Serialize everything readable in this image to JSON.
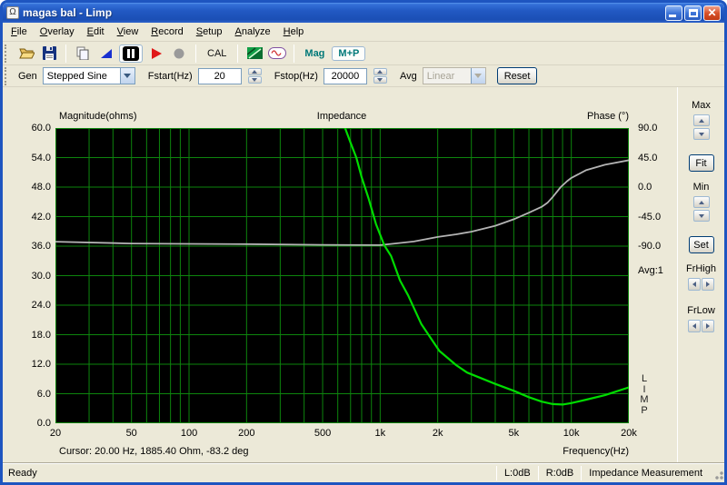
{
  "window": {
    "title": "magas bal - Limp",
    "icon": "limp-app-icon"
  },
  "menu": {
    "items": [
      "File",
      "Overlay",
      "Edit",
      "View",
      "Record",
      "Setup",
      "Analyze",
      "Help"
    ]
  },
  "toolbar": {
    "cal": "CAL",
    "mag": "Mag",
    "mp": "M+P",
    "icons": [
      "open-icon",
      "save-icon",
      "copy-icon",
      "flag-icon",
      "pause-icon",
      "play-icon",
      "record-icon",
      "overlay-pattern-icon",
      "generator-icon"
    ]
  },
  "controls": {
    "gen_label": "Gen",
    "gen_value": "Stepped Sine",
    "fstart_label": "Fstart(Hz)",
    "fstart_value": "20",
    "fstop_label": "Fstop(Hz)",
    "fstop_value": "20000",
    "avg_label": "Avg",
    "avg_value": "Linear",
    "reset": "Reset"
  },
  "side_panel": {
    "max": "Max",
    "fit": "Fit",
    "min": "Min",
    "set": "Set",
    "frhigh": "FrHigh",
    "frlow": "FrLow"
  },
  "chart": {
    "left_title": "Magnitude(ohms)",
    "center_title": "Impedance",
    "right_title": "Phase (°)",
    "avg_indicator": "Avg:1",
    "limp_letters": [
      "L",
      "I",
      "M",
      "P"
    ],
    "freq_label": "Frequency(Hz)",
    "cursor_text": "Cursor: 20.00 Hz, 1885.40 Ohm, -83.2 deg"
  },
  "chart_data": {
    "type": "line",
    "title": "Impedance",
    "x_axis": {
      "label": "Frequency(Hz)",
      "scale": "log",
      "min": 20,
      "max": 20000,
      "tick_values": [
        20,
        50,
        100,
        200,
        500,
        1000,
        2000,
        5000,
        10000,
        20000
      ],
      "tick_labels": [
        "20",
        "50",
        "100",
        "200",
        "500",
        "1k",
        "2k",
        "5k",
        "10k",
        "20k"
      ]
    },
    "y_left": {
      "label": "Magnitude(ohms)",
      "min": 0,
      "max": 60,
      "tick_step": 6
    },
    "y_right": {
      "label": "Phase (°)",
      "tick_values": [
        90,
        45,
        0,
        -45,
        -90
      ],
      "deg0_ohm": 48,
      "deg_per_ohm": 7.5
    },
    "plot_bg": "#000000",
    "grid_color": "#0d850d",
    "grid": true,
    "legend": "none",
    "series": [
      {
        "name": "magnitude",
        "axis": "left",
        "unit": "ohm",
        "color": "#00dc00",
        "x": [
          20,
          50,
          100,
          200,
          300,
          400,
          500,
          600,
          700,
          750,
          800,
          870,
          950,
          1050,
          1140,
          1270,
          1400,
          1640,
          2040,
          2500,
          2850,
          3400,
          4000,
          5000,
          6000,
          7000,
          8000,
          9000,
          10000,
          12000,
          15000,
          17000,
          20000
        ],
        "y": [
          1885.4,
          755,
          378,
          189,
          126,
          95,
          77,
          64,
          57,
          54,
          50,
          45.7,
          40.5,
          36.2,
          34,
          29,
          26,
          20.2,
          14.7,
          11.8,
          10.3,
          9.1,
          8.0,
          6.6,
          5.3,
          4.4,
          3.9,
          3.8,
          4.1,
          4.8,
          5.7,
          6.4,
          7.3
        ]
      },
      {
        "name": "phase",
        "axis": "right",
        "unit": "deg",
        "color": "#b4b4b4",
        "x": [
          20,
          50,
          100,
          200,
          500,
          1000,
          1500,
          2000,
          2500,
          3000,
          4000,
          5000,
          6000,
          7000,
          7500,
          8000,
          8800,
          9500,
          10000,
          12000,
          15000,
          20000
        ],
        "y": [
          -83.2,
          -86,
          -86.5,
          -87,
          -88,
          -88.5,
          -83,
          -76,
          -72,
          -68,
          -59,
          -49,
          -39,
          -30,
          -24,
          -15,
          0,
          9,
          14,
          26,
          34,
          41
        ]
      }
    ],
    "cursor": {
      "freq_hz": 20.0,
      "magnitude_ohm": 1885.4,
      "phase_deg": -83.2
    }
  },
  "status": {
    "ready": "Ready",
    "left_db": "L:0dB",
    "right_db": "R:0dB",
    "mode": "Impedance Measurement"
  }
}
